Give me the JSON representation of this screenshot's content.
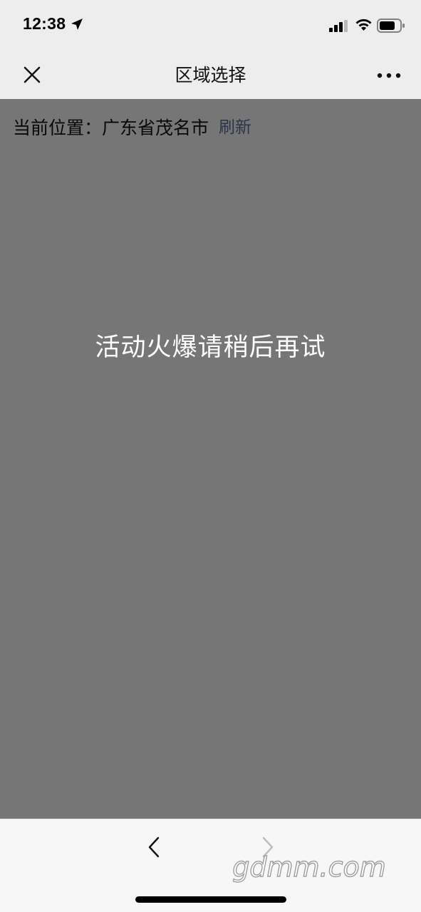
{
  "status_bar": {
    "time": "12:38",
    "location_icon": "location-arrow-icon",
    "signal_icon": "cellular-signal-icon",
    "wifi_icon": "wifi-icon",
    "battery_icon": "battery-icon"
  },
  "nav": {
    "title": "区域选择",
    "close_icon": "close-icon",
    "more_icon": "more-icon"
  },
  "location": {
    "label": "当前位置：",
    "value": "广东省茂名市",
    "refresh": "刷新"
  },
  "overlay": {
    "message": "活动火爆请稍后再试"
  },
  "bottom_bar": {
    "back_icon": "back-arrow-icon",
    "forward_icon": "forward-arrow-icon",
    "watermark": "gdmm.com"
  },
  "colors": {
    "background": "#ededed",
    "link": "#576b95",
    "overlay": "rgba(0,0,0,0.5)",
    "bottom_bar": "#f7f7f7"
  }
}
